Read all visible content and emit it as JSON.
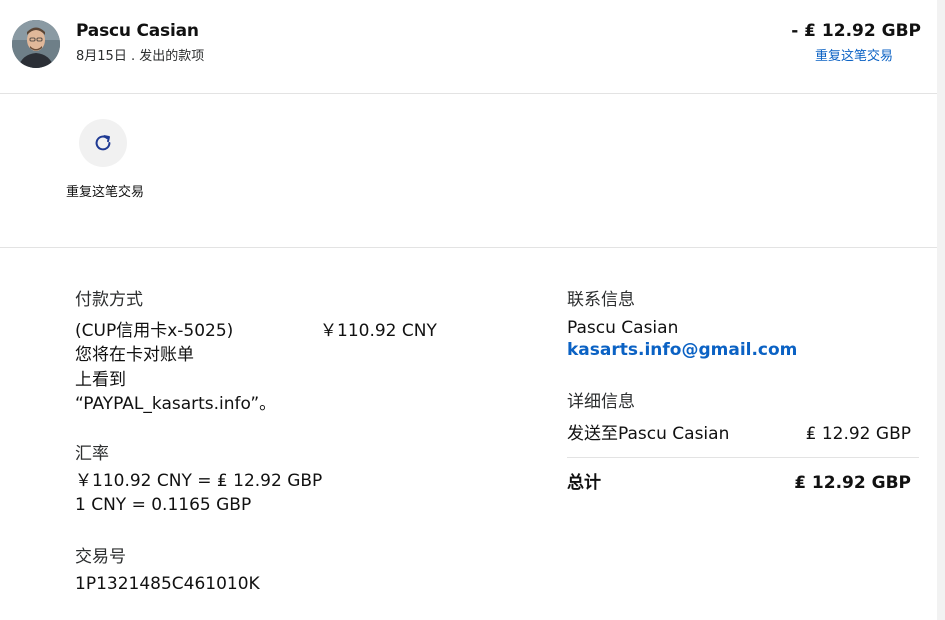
{
  "header": {
    "name": "Pascu Casian",
    "subtitle": "8月15日 . 发出的款项",
    "amount": "- ₤ 12.92 GBP",
    "repeat_link": "重复这笔交易"
  },
  "actions": {
    "repeat_label": "重复这笔交易",
    "repeat_icon": "refresh-icon"
  },
  "payment": {
    "label": "付款方式",
    "line1": "(CUP信用卡x-5025)",
    "line2": "您将在卡对账单",
    "line3": "上看到",
    "line4": "“PAYPAL_kasarts.info”。",
    "amount": "￥110.92 CNY"
  },
  "exchange": {
    "label": "汇率",
    "line1": "￥110.92 CNY = ₤ 12.92 GBP",
    "line2": "1 CNY = 0.1165 GBP"
  },
  "transaction": {
    "label": "交易号",
    "id": "1P1321485C461010K"
  },
  "contact": {
    "label": "联系信息",
    "name": "Pascu Casian",
    "email": "kasarts.info@gmail.com"
  },
  "details": {
    "label": "详细信息",
    "sent_to": "发送至Pascu Casian",
    "sent_amount": "₤ 12.92 GBP",
    "total_label": "总计",
    "total_amount": "₤ 12.92 GBP"
  },
  "colors": {
    "link": "#0b62c4",
    "icon": "#1f3a93"
  }
}
